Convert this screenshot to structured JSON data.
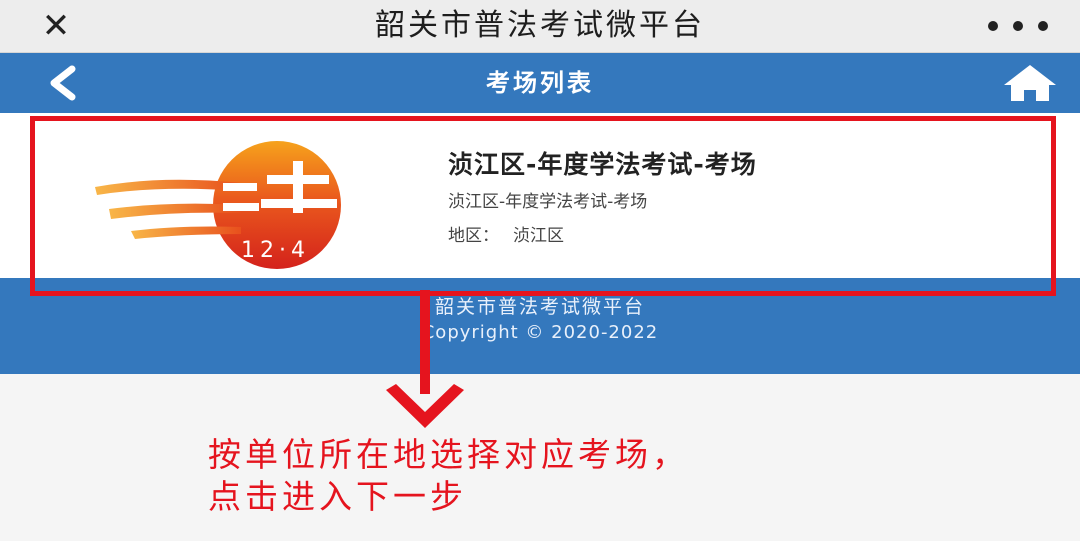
{
  "app": {
    "title": "韶关市普法考试微平台"
  },
  "navbar": {
    "title": "考场列表"
  },
  "exam_list": [
    {
      "title": "浈江区-年度学法考试-考场",
      "subtitle": "浈江区-年度学法考试-考场",
      "region_label": "地区：",
      "region_value": "浈江区",
      "logo_text": "12·4"
    }
  ],
  "footer": {
    "line1": "韶关市普法考试微平台",
    "copyright": "Copyright © 2020-2022"
  },
  "annotation": {
    "line1": "按单位所在地选择对应考场，",
    "line2": "点击进入下一步"
  },
  "colors": {
    "nav_blue": "#3478bd",
    "highlight_red": "#e5141e"
  },
  "icons": [
    "close-icon",
    "more-icon",
    "back-icon",
    "home-icon",
    "down-arrow-icon"
  ]
}
